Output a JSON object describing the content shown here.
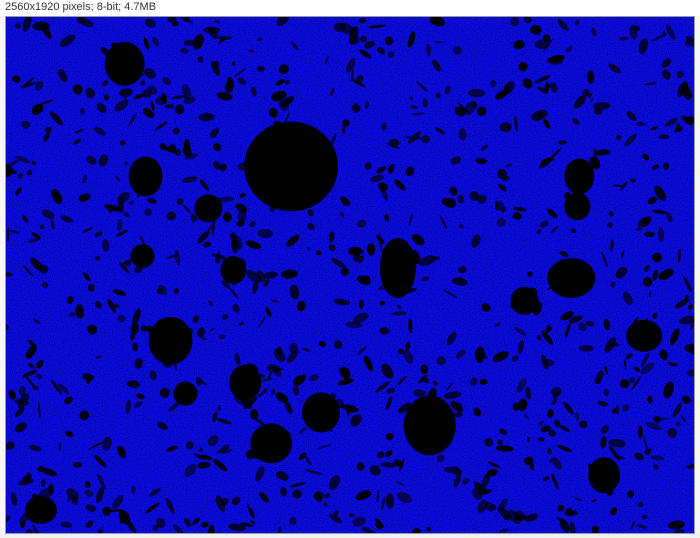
{
  "info_bar": {
    "text": "2560x1920 pixels; 8-bit; 4.7MB"
  },
  "image": {
    "content_icon": "blue-thresholded-tissue-micrograph",
    "background_color": "#000000",
    "foreground_color": "#1a1aff"
  }
}
